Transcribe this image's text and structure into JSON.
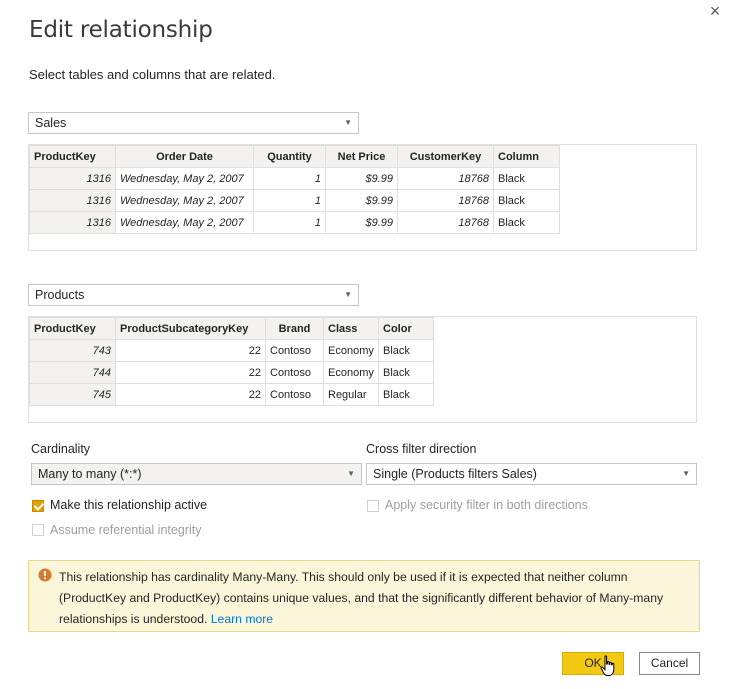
{
  "dialog": {
    "title": "Edit relationship",
    "subtitle": "Select tables and columns that are related.",
    "close_label": "×"
  },
  "table1": {
    "selected": "Sales",
    "columns": [
      "ProductKey",
      "Order Date",
      "Quantity",
      "Net Price",
      "CustomerKey",
      "Column"
    ],
    "rows": [
      [
        "1316",
        "Wednesday, May 2, 2007",
        "1",
        "$9.99",
        "18768",
        "Black"
      ],
      [
        "1316",
        "Wednesday, May 2, 2007",
        "1",
        "$9.99",
        "18768",
        "Black"
      ],
      [
        "1316",
        "Wednesday, May 2, 2007",
        "1",
        "$9.99",
        "18768",
        "Black"
      ]
    ]
  },
  "table2": {
    "selected": "Products",
    "columns": [
      "ProductKey",
      "ProductSubcategoryKey",
      "Brand",
      "Class",
      "Color"
    ],
    "rows": [
      [
        "743",
        "22",
        "Contoso",
        "Economy",
        "Black"
      ],
      [
        "744",
        "22",
        "Contoso",
        "Economy",
        "Black"
      ],
      [
        "745",
        "22",
        "Contoso",
        "Regular",
        "Black"
      ]
    ]
  },
  "cardinality": {
    "label": "Cardinality",
    "value": "Many to many (*:*)"
  },
  "cross_filter": {
    "label": "Cross filter direction",
    "value": "Single (Products filters Sales)"
  },
  "options": {
    "active_label": "Make this relationship active",
    "active_checked": true,
    "integrity_label": "Assume referential integrity",
    "integrity_checked": false,
    "security_label": "Apply security filter in both directions",
    "security_checked": false
  },
  "warning": {
    "text": "This relationship has cardinality Many-Many. This should only be used if it is expected that neither column (ProductKey and ProductKey) contains unique values, and that the significantly different behavior of Many-many relationships is understood.",
    "link": "Learn more"
  },
  "buttons": {
    "ok": "OK",
    "cancel": "Cancel"
  },
  "colors": {
    "accent": "#f2c811",
    "checkbox": "#e6a100",
    "warning_bg": "#fbf6d9",
    "link": "#0078d4"
  },
  "icons": {
    "close": "close-icon",
    "warning": "warning-icon",
    "chevron": "chevron-down-icon",
    "cursor": "hand-pointer-icon"
  }
}
